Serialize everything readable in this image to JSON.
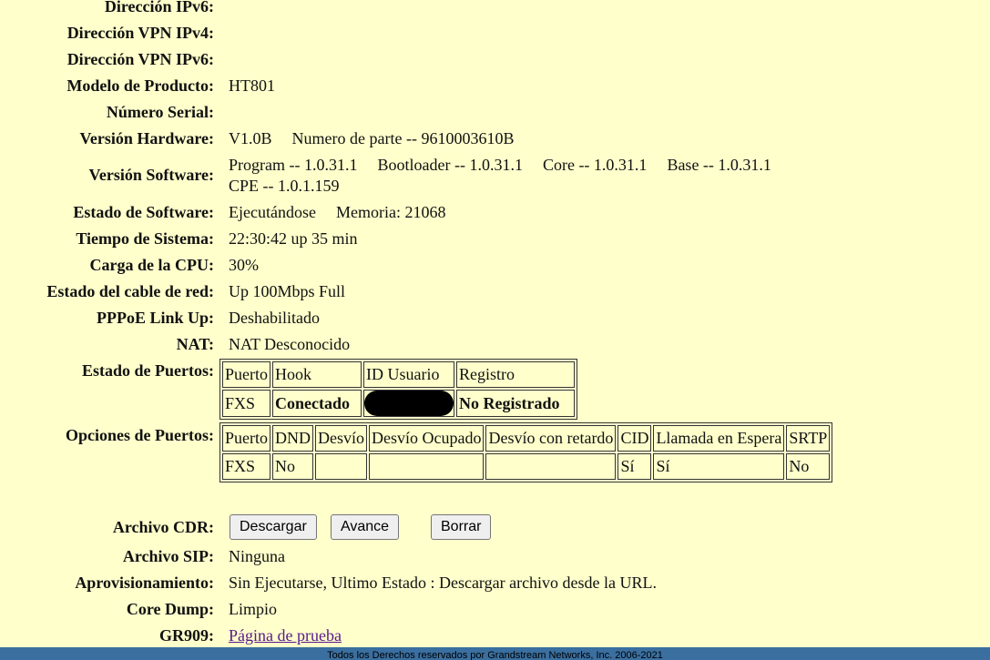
{
  "rows": {
    "ipv6": {
      "label": "Dirección IPv6:",
      "value": ""
    },
    "vpn_ipv4": {
      "label": "Dirección VPN IPv4:",
      "value": ""
    },
    "vpn_ipv6": {
      "label": "Dirección VPN IPv6:",
      "value": ""
    },
    "model": {
      "label": "Modelo de Producto:",
      "value": "HT801"
    },
    "serial": {
      "label": "Número Serial:",
      "value": ""
    },
    "hardware": {
      "label": "Versión Hardware:",
      "value": "V1.0B",
      "part": "Numero de parte -- 9610003610B"
    },
    "software": {
      "label": "Versión Software:",
      "program": "Program -- 1.0.31.1",
      "bootloader": "Bootloader -- 1.0.31.1",
      "core": "Core -- 1.0.31.1",
      "base": "Base -- 1.0.31.1",
      "cpe": "CPE -- 1.0.1.159"
    },
    "sw_state": {
      "label": "Estado de Software:",
      "value": "Ejecutándose",
      "memory": "Memoria: 21068"
    },
    "uptime": {
      "label": "Tiempo de Sistema:",
      "value": "22:30:42 up 35 min"
    },
    "cpu": {
      "label": "Carga de la CPU:",
      "value": "30%"
    },
    "cable": {
      "label": "Estado del cable de red:",
      "value": "Up 100Mbps Full"
    },
    "pppoe": {
      "label": "PPPoE Link Up:",
      "value": "Deshabilitado"
    },
    "nat": {
      "label": "NAT:",
      "value": "NAT Desconocido"
    },
    "port_status": {
      "label": "Estado de Puertos:"
    },
    "port_options": {
      "label": "Opciones de Puertos:"
    },
    "cdr": {
      "label": "Archivo CDR:"
    },
    "sip": {
      "label": "Archivo SIP:",
      "value": "Ninguna"
    },
    "provisioning": {
      "label": "Aprovisionamiento:",
      "value": "Sin Ejecutarse, Ultimo Estado : Descargar archivo desde la URL."
    },
    "core_dump": {
      "label": "Core Dump:",
      "value": "Limpio"
    },
    "gr909": {
      "label": "GR909:",
      "link": "Página de prueba"
    }
  },
  "port_status_table": {
    "headers": [
      "Puerto",
      "Hook",
      "ID Usuario",
      "Registro"
    ],
    "row": [
      "FXS",
      "Conectado",
      "",
      "No Registrado"
    ]
  },
  "port_options_table": {
    "headers": [
      "Puerto",
      "DND",
      "Desvío",
      "Desvío Ocupado",
      "Desvío con retardo",
      "CID",
      "Llamada en Espera",
      "SRTP"
    ],
    "row": [
      "FXS",
      "No",
      "",
      "",
      "",
      "Sí",
      "Sí",
      "No"
    ]
  },
  "buttons": {
    "download": "Descargar",
    "advance": "Avance",
    "delete": "Borrar"
  },
  "footer": "Todos los Derechos reservados por Grandstream Networks, Inc. 2006-2021"
}
